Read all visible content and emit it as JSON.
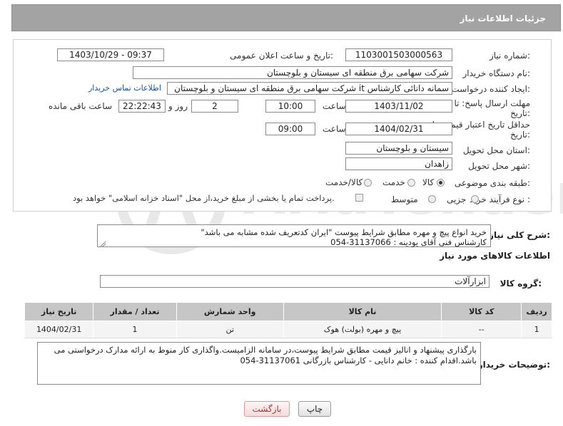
{
  "header": {
    "title": "جزئیات اطلاعات نیاز"
  },
  "form": {
    "need_number_label": "شماره نیاز:",
    "need_number": "1103001503000563",
    "announce_label": "تاریخ و ساعت اعلان عمومی:",
    "announce_value": "1403/10/29 - 09:37",
    "buyer_org_label": "نام دستگاه خریدار:",
    "buyer_org": "شرکت سهامی برق منطقه ای سیستان و بلوچستان",
    "creator_label": "ایجاد کننده درخواست:",
    "creator": "سمانه دانائی کارشناس it شرکت سهامی برق منطقه ای سیستان و بلوچستان",
    "contact_link": "اطلاعات تماس خریدار",
    "deadline_label_1": "مهلت ارسال پاسخ: تا",
    "deadline_label_2": "تاریخ:",
    "deadline_date": "1403/11/02",
    "time_label": "ساعت",
    "deadline_time": "10:00",
    "days_value": "2",
    "days_label": "روز و",
    "remaining_time": "22:22:43",
    "remaining_label": "ساعت باقی مانده",
    "validity_label_1": "حداقل تاریخ اعتبار قیمت: تا",
    "validity_label_2": "تاریخ:",
    "validity_date": "1404/02/31",
    "validity_time": "09:00",
    "province_label": "استان محل تحویل:",
    "province": "سیستان و بلوچستان",
    "city_label": "شهر محل تحویل:",
    "city": "زاهدان",
    "category_label": "طبقه بندی موضوعی:",
    "category_options": [
      "کالا",
      "خدمت",
      "کالا/خدمت"
    ],
    "process_label": "نوع فرآیند خرید :",
    "process_options": [
      "جزیی",
      "متوسط"
    ],
    "payment_note": "پرداخت تمام یا بخشی از مبلغ خرید،از محل \"اسناد خزانه اسلامی\" خواهد بود."
  },
  "description": {
    "label": "شرح کلی نیاز:",
    "line1": "خرید انواع پیچ و مهره مطابق شرایط پیوست \"ایران کدتعریف شده مشابه می باشد\"",
    "line2": "کارشناس فنی آقای یودینه : 31137066-054"
  },
  "goods_section": {
    "title": "اطلاعات کالاهای مورد نیاز",
    "group_label": "گروه کالا:",
    "group_value": "ابزارآلات"
  },
  "table": {
    "headers": [
      "ردیف",
      "کد کالا",
      "نام کالا",
      "واحد شمارش",
      "تعداد / مقدار",
      "تاریخ نیاز"
    ],
    "rows": [
      [
        "1",
        "--",
        "پیچ و مهره (بولت) هوک",
        "تن",
        "1",
        "1404/02/31"
      ]
    ]
  },
  "buyer_notes": {
    "label": "توضیحات خریدار:",
    "line1": "بارگذاری پیشنهاد و انالیز قیمت مطابق شرایط پیوست،در سامانه الزامیست.واگذاری کار منوط به ارائه مدارک درخواستی می",
    "line2": "باشد.اقدام کننده : خانم دانایی - کارشناس بازرگانی 31137061-054"
  },
  "buttons": {
    "print": "چاپ",
    "back": "بازگشت"
  },
  "colors": {
    "header_bg": "#a3a3a3",
    "link": "#1a4fb5",
    "table_header": "#c6c6c6"
  }
}
